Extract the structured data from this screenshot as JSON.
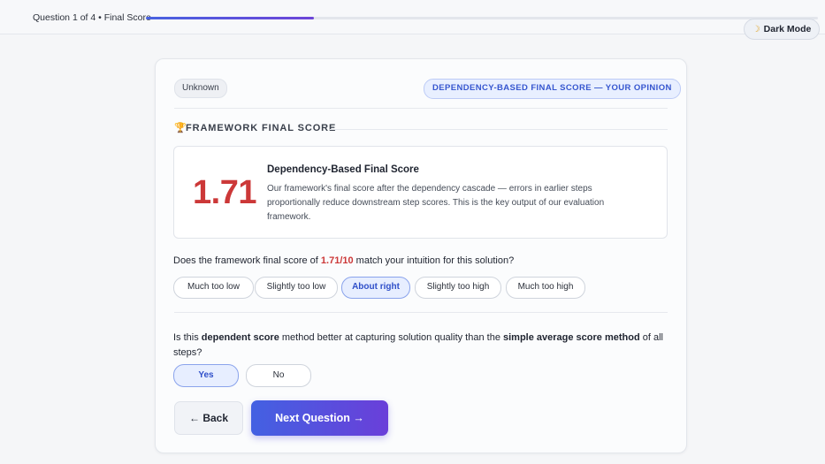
{
  "topbar": {
    "question_label": "Question 1 of 4 • Final Score",
    "progress": 0.25,
    "dark_mode_label": "Dark Mode"
  },
  "card": {
    "tag_unknown": "Unknown",
    "tag_method": "DEPENDENCY-BASED FINAL SCORE — YOUR OPINION",
    "section_title": "FRAMEWORK FINAL SCORE",
    "score": {
      "value": "1.71",
      "title": "Dependency-Based Final Score",
      "description": "Our framework's final score after the dependency cascade — errors in earlier steps proportionally reduce downstream step scores. This is the key output of our evaluation framework."
    },
    "question1": {
      "prefix": "Does the framework final score of ",
      "highlight": "1.71/10",
      "suffix": " match your intuition for this solution?",
      "options": [
        "Much too low",
        "Slightly too low",
        "About right",
        "Slightly too high",
        "Much too high"
      ],
      "selected": "About right"
    },
    "question2": {
      "part1": "Is this ",
      "bold1": "dependent score",
      "part2": " method better at capturing solution quality than the ",
      "bold2": "simple average score method",
      "part3": " of all steps?",
      "options": [
        "Yes",
        "No"
      ],
      "selected": "Yes"
    },
    "back_label": "← Back",
    "next_label": "Next Question →"
  },
  "colors": {
    "accent": "#4361e2",
    "score_red": "#cc3838",
    "selected_bg": "#e7eeff"
  }
}
